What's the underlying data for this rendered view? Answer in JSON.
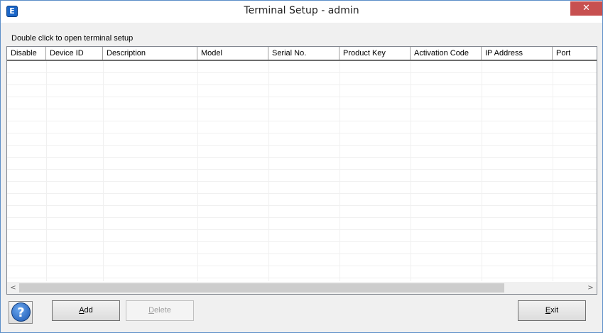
{
  "window": {
    "title": "Terminal Setup - admin",
    "app_icon_letter": "E",
    "close_glyph": "✕"
  },
  "hint_text": "Double click to open terminal setup",
  "table": {
    "columns": [
      {
        "label": "Disable"
      },
      {
        "label": "Device ID"
      },
      {
        "label": "Description"
      },
      {
        "label": "Model"
      },
      {
        "label": "Serial No."
      },
      {
        "label": "Product Key"
      },
      {
        "label": "Activation Code"
      },
      {
        "label": "IP Address"
      },
      {
        "label": "Port"
      }
    ],
    "rows": []
  },
  "buttons": {
    "help_glyph": "?",
    "add_prefix": "A",
    "add_rest": "dd",
    "delete_prefix": "D",
    "delete_rest": "elete",
    "exit_prefix": "E",
    "exit_rest": "xit"
  },
  "scrollbar": {
    "left_arrow": "<",
    "right_arrow": ">"
  },
  "colors": {
    "close_red": "#c75050",
    "window_border": "#5c8fc8",
    "help_blue": "#1a55b0"
  }
}
